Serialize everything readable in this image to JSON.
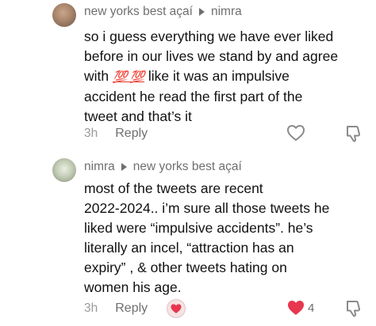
{
  "comments": [
    {
      "author": "new yorks best açaí",
      "reply_to": "nimra",
      "lines": [
        "so i guess everything we have ever liked",
        "before in our lives we stand by and agree",
        "with",
        "like it was an impulsive",
        "accident he read the first part of the",
        "tweet and that’s it"
      ],
      "emoji": "💯 💯",
      "time": "3h",
      "reply_label": "Reply",
      "liked": false,
      "like_count": ""
    },
    {
      "author": "nimra",
      "reply_to": "new yorks best açaí",
      "lines": [
        "most of the tweets are recent",
        "2022-2024.. i’m sure all those tweets he",
        "liked were “impulsive accidents”. he’s",
        "literally an incel, “attraction has an",
        "expiry” , & other tweets hating on",
        "women his age."
      ],
      "time": "3h",
      "reply_label": "Reply",
      "liked": true,
      "like_count": "4"
    }
  ],
  "colors": {
    "heart_active": "#e8364f",
    "muted_text": "#6f6f6f",
    "body_text": "#111111"
  },
  "icons": [
    "heart-outline-icon",
    "dislike-icon",
    "heart-filled-icon",
    "reply-arrow-icon"
  ]
}
